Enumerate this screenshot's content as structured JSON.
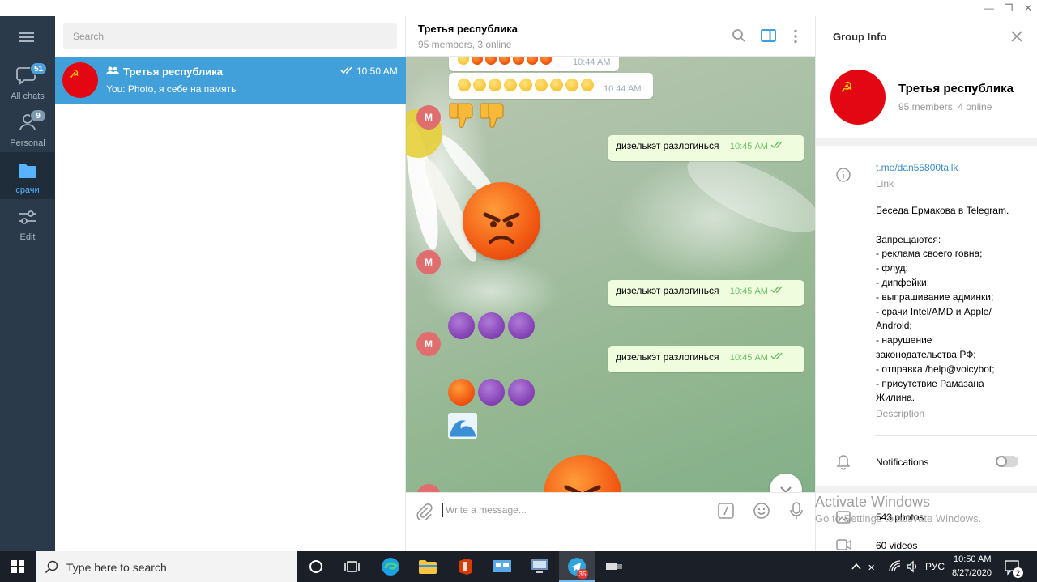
{
  "window": {
    "controls": [
      "—",
      "❐",
      "✕"
    ]
  },
  "sidebar": {
    "items": [
      {
        "label": "All chats",
        "badge": "51",
        "icon": "chats-icon"
      },
      {
        "label": "Personal",
        "badge": "9",
        "icon": "person-icon"
      },
      {
        "label": "срачи",
        "icon": "folder-icon",
        "active": true
      },
      {
        "label": "Edit",
        "icon": "sliders-icon"
      }
    ]
  },
  "chatlist": {
    "search_placeholder": "Search",
    "chats": [
      {
        "title": "Третья республика",
        "time": "10:50 AM",
        "preview": "You: Photo, я себе на память"
      }
    ]
  },
  "chat": {
    "title": "Третья республика",
    "status": "95 members, 3 online",
    "messages": [
      {
        "time": "10:44 AM"
      },
      {
        "time": "10:44 AM"
      },
      {
        "avatar": "M"
      },
      {
        "text": "дизелькэт разлогинься",
        "time": "10:45 AM"
      },
      {
        "avatar": "M"
      },
      {
        "text": "дизелькэт разлогинься",
        "time": "10:45 AM"
      },
      {
        "avatar": "M"
      },
      {
        "text": "дизелькэт разлогинься",
        "time": "10:45 AM"
      },
      {
        "avatar": "M"
      }
    ],
    "composer_placeholder": "Write a message..."
  },
  "info": {
    "header": "Group Info",
    "name": "Третья республика",
    "status": "95 members, 4 online",
    "link": "t.me/dan55800tallk",
    "link_label": "Link",
    "description_lines": [
      "Беседа Ермакова в Telegram.",
      "",
      "Запрещаются:",
      "- реклама своего говна;",
      "- флуд;",
      "- дипфейки;",
      "- выпрашивание админки;",
      "- срачи Intel/AMD и Apple/",
      "Android;",
      "- нарушение",
      "законодательства РФ;",
      "- отправка /help@voicybot;",
      "- присутствие Рамазана",
      "Жилина."
    ],
    "description_label": "Description",
    "notifications_label": "Notifications",
    "photos": "543 photos",
    "videos": "60 videos"
  },
  "watermark": {
    "line1": "Activate Windows",
    "line2": "Go to Settings to activate Windows."
  },
  "taskbar": {
    "search_placeholder": "Type here to search",
    "telegram_badge": "35",
    "language": "РУС",
    "time": "10:50 AM",
    "date": "8/27/2020",
    "notification_count": "2"
  },
  "colors": {
    "sidebar": "#2b3a4a",
    "accent": "#419fd9",
    "outgoing_bubble": "#effdde",
    "read_check": "#6cbf62",
    "flag_red": "#e30613"
  }
}
